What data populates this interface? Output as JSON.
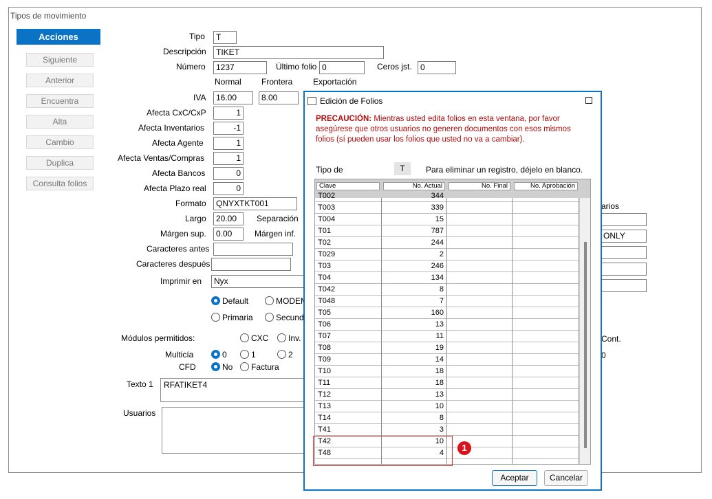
{
  "window": {
    "title": "Tipos de movimiento"
  },
  "actions": {
    "header": "Acciones",
    "items": [
      "Siguiente",
      "Anterior",
      "Encuentra",
      "Alta",
      "Cambio",
      "Duplica",
      "Consulta folios"
    ]
  },
  "form": {
    "tipo_label": "Tipo",
    "tipo_value": "T",
    "descripcion_label": "Descripción",
    "descripcion_value": "TIKET",
    "numero_label": "Número",
    "numero_value": "1237",
    "ultimo_folio_label": "Último folio",
    "ultimo_folio_value": "0",
    "ceros_label": "Ceros jst.",
    "ceros_value": "0",
    "col_normal": "Normal",
    "col_frontera": "Frontera",
    "col_exportacion": "Exportación",
    "iva_label": "IVA",
    "iva_normal": "16.00",
    "iva_frontera": "8.00",
    "afecta_cxc_label": "Afecta CxC/CxP",
    "afecta_cxc_value": "1",
    "afecta_inv_label": "Afecta Inventarios",
    "afecta_inv_value": "-1",
    "afecta_agente_label": "Afecta Agente",
    "afecta_agente_value": "1",
    "afecta_ventas_label": "Afecta Ventas/Compras",
    "afecta_ventas_value": "1",
    "afecta_bancos_label": "Afecta Bancos",
    "afecta_bancos_value": "0",
    "afecta_plazo_label": "Afecta Plazo real",
    "afecta_plazo_value": "0",
    "formato_label": "Formato",
    "formato_value": "QNYXTKT001",
    "largo_label": "Largo",
    "largo_value": "20.00",
    "separacion_label": "Separación",
    "margen_sup_label": "Márgen sup.",
    "margen_sup_value": "0.00",
    "margen_inf_label": "Márgen inf.",
    "car_antes_label": "Caracteres antes",
    "car_despues_label": "Caracteres después",
    "imprimir_label": "Imprimir en",
    "imprimir_value": "Nyx",
    "radio_default": "Default",
    "radio_modem": "MODEM",
    "radio_primaria": "Primaria",
    "radio_secund": "Secund",
    "modulos_label": "Módulos permitidos:",
    "mod_cxc": "CXC",
    "mod_inv": "Inv.",
    "multicia_label": "Multicía",
    "multicia_0": "0",
    "multicia_1": "1",
    "multicia_2": "2",
    "cfd_label": "CFD",
    "cfd_no": "No",
    "cfd_factura": "Factura",
    "texto1_label": "Texto 1",
    "texto1_value": "RFATIKET4",
    "usuarios_label": "Usuarios",
    "right_partial_1": "arios",
    "right_partial_2": "ONLY",
    "right_partial_3": "Cont.",
    "right_partial_4": "0"
  },
  "dialog": {
    "title": "Edición de Folios",
    "warning_bold": "PRECAUCIÓN:",
    "warning_text_1": " Mientras usted edita folios en esta ventana, por favor",
    "warning_text_2": "asegúrese que otros usuarios no generen documentos con esos mismos",
    "warning_text_3": "folios  (sí pueden usar los folios que usted no va a cambiar).",
    "tipo_de_label": "Tipo de",
    "tipo_de_value": "T",
    "instruction": "Para eliminar un registro, déjelo en blanco.",
    "columns": [
      "Clave",
      "No. Actual",
      "No. Final",
      "No. Aprobación"
    ],
    "rows": [
      {
        "clave": "T002",
        "actual": "344"
      },
      {
        "clave": "T003",
        "actual": "339"
      },
      {
        "clave": "T004",
        "actual": "15"
      },
      {
        "clave": "T01",
        "actual": "787"
      },
      {
        "clave": "T02",
        "actual": "244"
      },
      {
        "clave": "T029",
        "actual": "2"
      },
      {
        "clave": "T03",
        "actual": "246"
      },
      {
        "clave": "T04",
        "actual": "134"
      },
      {
        "clave": "T042",
        "actual": "8"
      },
      {
        "clave": "T048",
        "actual": "7"
      },
      {
        "clave": "T05",
        "actual": "160"
      },
      {
        "clave": "T06",
        "actual": "13"
      },
      {
        "clave": "T07",
        "actual": "11"
      },
      {
        "clave": "T08",
        "actual": "19"
      },
      {
        "clave": "T09",
        "actual": "14"
      },
      {
        "clave": "T10",
        "actual": "18"
      },
      {
        "clave": "T11",
        "actual": "18"
      },
      {
        "clave": "T12",
        "actual": "13"
      },
      {
        "clave": "T13",
        "actual": "10"
      },
      {
        "clave": "T14",
        "actual": "8"
      },
      {
        "clave": "T41",
        "actual": "3"
      },
      {
        "clave": "T42",
        "actual": "10"
      },
      {
        "clave": "T48",
        "actual": "4"
      }
    ],
    "accept": "Aceptar",
    "cancel": "Cancelar"
  },
  "annotation": {
    "badge": "1",
    "color": "#d9131b"
  }
}
